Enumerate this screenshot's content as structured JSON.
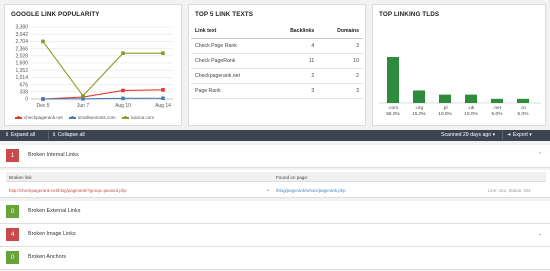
{
  "panels": {
    "popularity": {
      "title": "GOOGLE LINK POPULARITY",
      "legend": [
        "checkpagerank.net",
        "smallseotools.com",
        "icanna.com"
      ],
      "chart_data": {
        "type": "line",
        "x": [
          "Dec 5",
          "Jun 7",
          "Aug 10",
          "Aug 14"
        ],
        "yticks": [
          "0",
          "338",
          "676",
          "1,014",
          "1,352",
          "1,690",
          "2,028",
          "2,366",
          "2,704",
          "3,042",
          "3,380"
        ],
        "ylim": [
          0,
          3380
        ],
        "series": [
          {
            "name": "checkpagerank.net",
            "color": "#e03c2f",
            "values": [
              0,
              90,
              400,
              430
            ]
          },
          {
            "name": "smallseotools.com",
            "color": "#4a7fb5",
            "values": [
              0,
              10,
              30,
              35
            ]
          },
          {
            "name": "icanna.com",
            "color": "#8a9a2a",
            "values": [
              2704,
              150,
              2150,
              2150
            ]
          }
        ]
      }
    },
    "link_texts": {
      "title": "TOP 5 LINK TEXTS",
      "headers": [
        "Link text",
        "Backlinks",
        "Domains"
      ],
      "rows": [
        {
          "text": "Check Page Rank",
          "backlinks": "4",
          "domains": "3"
        },
        {
          "text": "Check PageRank",
          "backlinks": "11",
          "domains": "10"
        },
        {
          "text": "Checkpagerank.net",
          "backlinks": "2",
          "domains": "2"
        },
        {
          "text": "Page Rank",
          "backlinks": "3",
          "domains": "3"
        }
      ]
    },
    "tlds": {
      "title": "TOP LINKING TLDS",
      "chart_data": {
        "type": "bar",
        "categories": [
          ".com",
          ".org",
          ".pl",
          ".uk",
          ".net",
          ".ro"
        ],
        "values": [
          55.0,
          15.0,
          10.0,
          10.0,
          5.0,
          5.0
        ],
        "labels": [
          "55.0%",
          "15.0%",
          "10.0%",
          "10.0%",
          "5.0%",
          "5.0%"
        ],
        "color": "#2e8b3e"
      }
    }
  },
  "toolbar": {
    "expand_label": "Expand all",
    "collapse_label": "Collapse all",
    "scanned_label": "Scanned 29 days ago",
    "export_label": "Export"
  },
  "sections": {
    "internal": {
      "count": "1",
      "label": "Broken Internal Links"
    },
    "external": {
      "count": "0",
      "label": "Broken External Links"
    },
    "image": {
      "count": "4",
      "label": "Broken Image Links"
    },
    "anchors": {
      "count": "0",
      "label": "Broken Anchors"
    }
  },
  "detail": {
    "col_broken": "Broken link",
    "col_found": "Found on page:",
    "broken_url": "http://checkpagerank.net/blog/pagerank/?group=paused.php",
    "found_url": "/blog/pagerank/whois/pagerank.php",
    "meta": "Line: 151, Status: 404"
  }
}
